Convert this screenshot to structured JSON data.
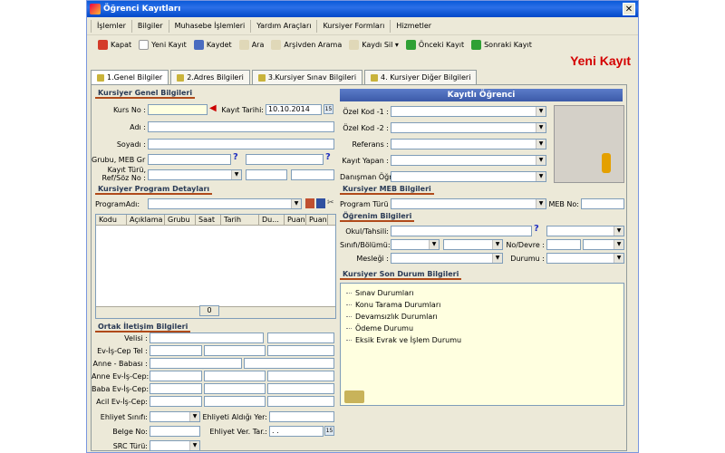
{
  "window": {
    "title": "Öğrenci Kayıtları",
    "close": "✕"
  },
  "menu": [
    "İşlemler",
    "Bilgiler",
    "Muhasebe İşlemleri",
    "Yardım Araçları",
    "Kursiyer Formları",
    "Hizmetler"
  ],
  "toolbar": [
    {
      "label": "Kapat",
      "icon": "close-icon",
      "color": "#d43c2a"
    },
    {
      "label": "Yeni Kayıt",
      "icon": "new-document-icon",
      "color": "#ffffff"
    },
    {
      "label": "Kaydet",
      "icon": "save-icon",
      "color": "#4a6cc0"
    },
    {
      "label": "Ara",
      "icon": "search-icon",
      "color": "#e0d8b8"
    },
    {
      "label": "Arşivden Arama",
      "icon": "archive-search-icon",
      "color": "#e0d8b8"
    },
    {
      "label": "Kaydı Sil",
      "icon": "delete-icon",
      "color": "#e0d8b8"
    },
    {
      "label": "Önceki Kayıt",
      "icon": "previous-icon",
      "color": "#2fa035"
    },
    {
      "label": "Sonraki Kayıt",
      "icon": "next-icon",
      "color": "#2fa035"
    }
  ],
  "banner": {
    "new_record": "Yeni Kayıt",
    "color": "#d40000"
  },
  "tabs": [
    "1.Genel Bilgiler",
    "2.Adres Bilgileri",
    "3.Kursiyer Sınav Bilgileri",
    "4. Kursiyer Diğer Bilgileri"
  ],
  "general": {
    "header": "Kursiyer Genel Bilgileri",
    "kurs_no": "Kurs No :",
    "kayit_tarihi": "Kayıt Tarihi:",
    "kayit_tarihi_value": "10.10.2014",
    "adi": "Adı :",
    "soyadi": "Soyadı :",
    "grubu": "Grubu, MEB Gr :",
    "kayit_turu": "Kayıt Türü,",
    "ref_soz": "Ref/Söz No :"
  },
  "program": {
    "header": "Kursiyer Program Detayları",
    "program_adi": "ProgramAdı:",
    "columns": [
      "Kodu",
      "Açıklama",
      "Grubu",
      "Saat",
      "Tarih",
      "Du...",
      "Puan",
      "Puan"
    ],
    "count": "0"
  },
  "contact": {
    "header": "Ortak İletişim Bilgileri",
    "labels": [
      "Velisi :",
      "Ev-İş-Cep Tel :",
      "Anne - Babası :",
      "Anne Ev-İş-Cep:",
      "Baba Ev-İş-Cep:",
      "Acil Ev-İş-Cep:"
    ],
    "ehliyet_sinifi": "Ehliyet Sınıfı:",
    "ehliyet_yer": "Ehliyeti Aldığı Yer:",
    "belge_no": "Belge No:",
    "ehliyet_tar": "Ehliyet Ver. Tar.:",
    "ehliyet_tar_value": ". .",
    "src_turu": "SRC Türü:"
  },
  "registered": {
    "header": "Kayıtlı Öğrenci",
    "ozel1": "Özel Kod -1 :",
    "ozel2": "Özel Kod -2 :",
    "referans": "Referans :",
    "kayit_yapan": "Kayıt Yapan :",
    "danisman": "Danışman Öğr:"
  },
  "meb": {
    "header": "Kursiyer MEB Bilgileri",
    "program_turu": "Program Türü :",
    "meb_no": "MEB No:"
  },
  "education": {
    "header": "Öğrenim Bilgileri",
    "okul": "Okul/Tahsili:",
    "sinif": "Sınıfı/Bölümü:",
    "no_devre": "No/Devre :",
    "meslegi": "Mesleği :",
    "durumu": "Durumu :"
  },
  "status": {
    "header": "Kursiyer Son Durum Bilgileri",
    "items": [
      "Sınav Durumları",
      "Konu Tarama Durumları",
      "Devamsızlık Durumları",
      "Ödeme Durumu",
      "Eksik Evrak ve İşlem Durumu"
    ]
  }
}
